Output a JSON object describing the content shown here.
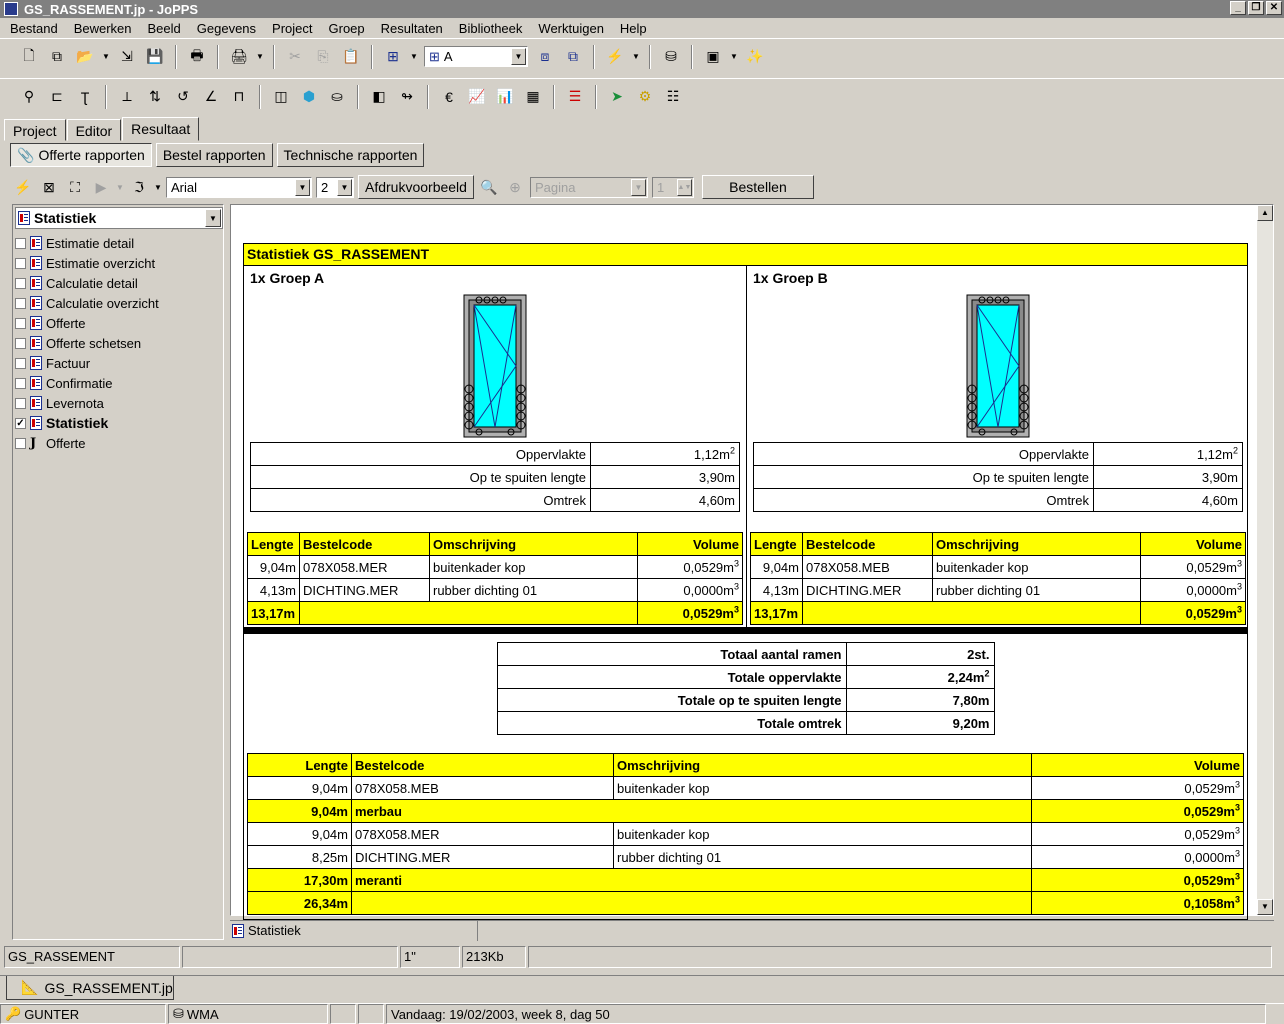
{
  "window": {
    "title": "GS_RASSEMENT.jp - JoPPS"
  },
  "menu": [
    "Bestand",
    "Bewerken",
    "Beeld",
    "Gegevens",
    "Project",
    "Groep",
    "Resultaten",
    "Bibliotheek",
    "Werktuigen",
    "Help"
  ],
  "toolbar": {
    "group_combo": "A"
  },
  "main_tabs": [
    "Project",
    "Editor",
    "Resultaat"
  ],
  "sub_tabs": [
    "Offerte rapporten",
    "Bestel rapporten",
    "Technische rapporten"
  ],
  "report_toolbar": {
    "font": "Arial",
    "size": "2",
    "preview_label": "Afdrukvoorbeeld",
    "page_placeholder": "Pagina",
    "page_value": "1",
    "order_label": "Bestellen"
  },
  "left_panel": {
    "combo": "Statistiek",
    "items": [
      {
        "label": "Estimatie detail",
        "checked": false
      },
      {
        "label": "Estimatie overzicht",
        "checked": false
      },
      {
        "label": "Calculatie detail",
        "checked": false
      },
      {
        "label": "Calculatie overzicht",
        "checked": false
      },
      {
        "label": "Offerte",
        "checked": false
      },
      {
        "label": "Offerte schetsen",
        "checked": false
      },
      {
        "label": "Factuur",
        "checked": false
      },
      {
        "label": "Confirmatie",
        "checked": false
      },
      {
        "label": "Levernota",
        "checked": false
      },
      {
        "label": "Statistiek",
        "checked": true
      },
      {
        "label": "Offerte",
        "checked": false
      }
    ]
  },
  "report": {
    "title": "Statistiek GS_RASSEMENT",
    "groups": [
      {
        "name": "1x Groep A",
        "props": [
          {
            "label": "Oppervlakte",
            "value": "1,12m",
            "sup": "2"
          },
          {
            "label": "Op te spuiten lengte",
            "value": "3,90m",
            "sup": ""
          },
          {
            "label": "Omtrek",
            "value": "4,60m",
            "sup": ""
          }
        ],
        "headers": [
          "Lengte",
          "Bestelcode",
          "Omschrijving",
          "Volume"
        ],
        "rows": [
          {
            "lengte": "9,04m",
            "code": "078X058.MER",
            "omschr": "buitenkader kop",
            "volume": "0,0529m"
          },
          {
            "lengte": "4,13m",
            "code": "DICHTING.MER",
            "omschr": "rubber dichting 01",
            "volume": "0,0000m"
          }
        ],
        "total": {
          "lengte": "13,17m",
          "volume": "0,0529m"
        }
      },
      {
        "name": "1x Groep B",
        "props": [
          {
            "label": "Oppervlakte",
            "value": "1,12m",
            "sup": "2"
          },
          {
            "label": "Op te spuiten lengte",
            "value": "3,90m",
            "sup": ""
          },
          {
            "label": "Omtrek",
            "value": "4,60m",
            "sup": ""
          }
        ],
        "headers": [
          "Lengte",
          "Bestelcode",
          "Omschrijving",
          "Volume"
        ],
        "rows": [
          {
            "lengte": "9,04m",
            "code": "078X058.MEB",
            "omschr": "buitenkader kop",
            "volume": "0,0529m"
          },
          {
            "lengte": "4,13m",
            "code": "DICHTING.MER",
            "omschr": "rubber dichting 01",
            "volume": "0,0000m"
          }
        ],
        "total": {
          "lengte": "13,17m",
          "volume": "0,0529m"
        }
      }
    ],
    "totals": [
      {
        "label": "Totaal aantal ramen",
        "value": "2st.",
        "sup": ""
      },
      {
        "label": "Totale oppervlakte",
        "value": "2,24m",
        "sup": "2"
      },
      {
        "label": "Totale op te spuiten lengte",
        "value": "7,80m",
        "sup": ""
      },
      {
        "label": "Totale omtrek",
        "value": "9,20m",
        "sup": ""
      }
    ],
    "overall_headers": [
      "Lengte",
      "Bestelcode",
      "Omschrijving",
      "Volume"
    ],
    "overall_rows": [
      {
        "type": "row",
        "lengte": "9,04m",
        "code": "078X058.MEB",
        "omschr": "buitenkader kop",
        "volume": "0,0529m"
      },
      {
        "type": "sub",
        "lengte": "9,04m",
        "code": "merbau",
        "omschr": "",
        "volume": "0,0529m"
      },
      {
        "type": "row",
        "lengte": "9,04m",
        "code": "078X058.MER",
        "omschr": "buitenkader kop",
        "volume": "0,0529m"
      },
      {
        "type": "row",
        "lengte": "8,25m",
        "code": "DICHTING.MER",
        "omschr": "rubber dichting 01",
        "volume": "0,0000m"
      },
      {
        "type": "sub",
        "lengte": "17,30m",
        "code": "meranti",
        "omschr": "",
        "volume": "0,0529m"
      },
      {
        "type": "sub",
        "lengte": "26,34m",
        "code": "",
        "omschr": "",
        "volume": "0,1058m"
      }
    ],
    "volume_sup": "3"
  },
  "bottom_tab": "Statistiek",
  "status": {
    "file": "GS_RASSEMENT",
    "empty": "",
    "time": "1\"",
    "size": "213Kb"
  },
  "doc_tab": "GS_RASSEMENT.jp",
  "taskbar": {
    "user": "GUNTER",
    "db": "WMA",
    "date": "Vandaag: 19/02/2003, week 8, dag 50"
  }
}
